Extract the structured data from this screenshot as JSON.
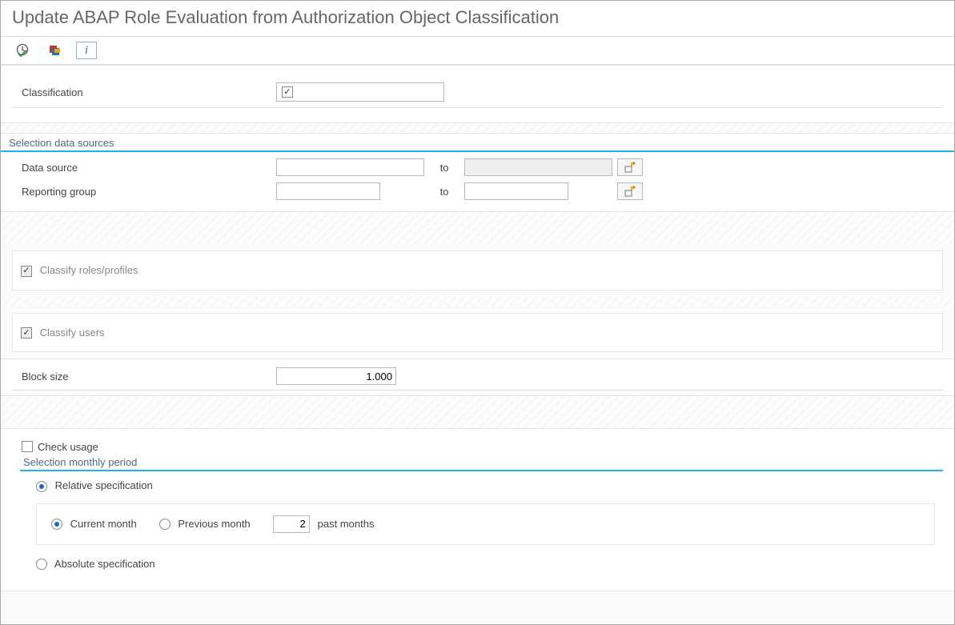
{
  "title": "Update ABAP Role Evaluation from Authorization Object Classification",
  "toolbar": {
    "execute": "Execute",
    "variant": "Get Variant",
    "info": "Information"
  },
  "classification": {
    "label": "Classification",
    "value": ""
  },
  "sel_sources": {
    "title": "Selection data sources",
    "data_source": {
      "label": "Data source",
      "from": "",
      "to": ""
    },
    "reporting_group": {
      "label": "Reporting group",
      "from": "",
      "to": ""
    },
    "to": "to"
  },
  "classify_roles": "Classify roles/profiles",
  "classify_users": "Classify users",
  "block_size": {
    "label": "Block size",
    "value": "1.000"
  },
  "check_usage": "Check usage",
  "sel_period": {
    "title": "Selection monthly period",
    "relative": "Relative specification",
    "current": "Current month",
    "previous": "Previous month",
    "past_value": "2",
    "past_label": "past months",
    "absolute": "Absolute specification"
  }
}
